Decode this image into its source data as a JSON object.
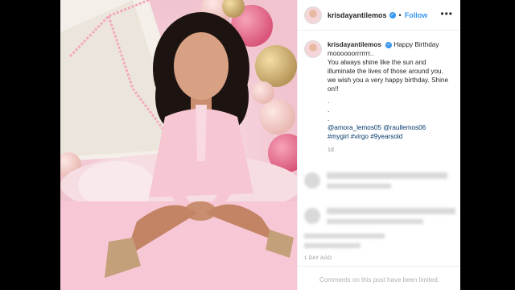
{
  "post": {
    "username": "krisdayantilemos",
    "verified_mark": "✓",
    "separator": "•",
    "follow_label": "Follow",
    "more_label": "•••"
  },
  "caption": {
    "username": "krisdayantilemos",
    "lines": [
      "Happy Birthday moooooorrrrrrr..",
      "You always shine like the sun and illuminate the lives of those around you. we wish you a very happy birthday. Shine on!!",
      ".",
      ".",
      "."
    ],
    "mentions": "@amora_lemos05 @raullemos06",
    "hashtags": "#mygirl #virgo #9yearsold",
    "age": "1d"
  },
  "footer": {
    "date": "1 DAY AGO",
    "comments_notice": "Comments on this post have been limited."
  },
  "colors": {
    "accent": "#3897f0",
    "background": "#000000"
  }
}
